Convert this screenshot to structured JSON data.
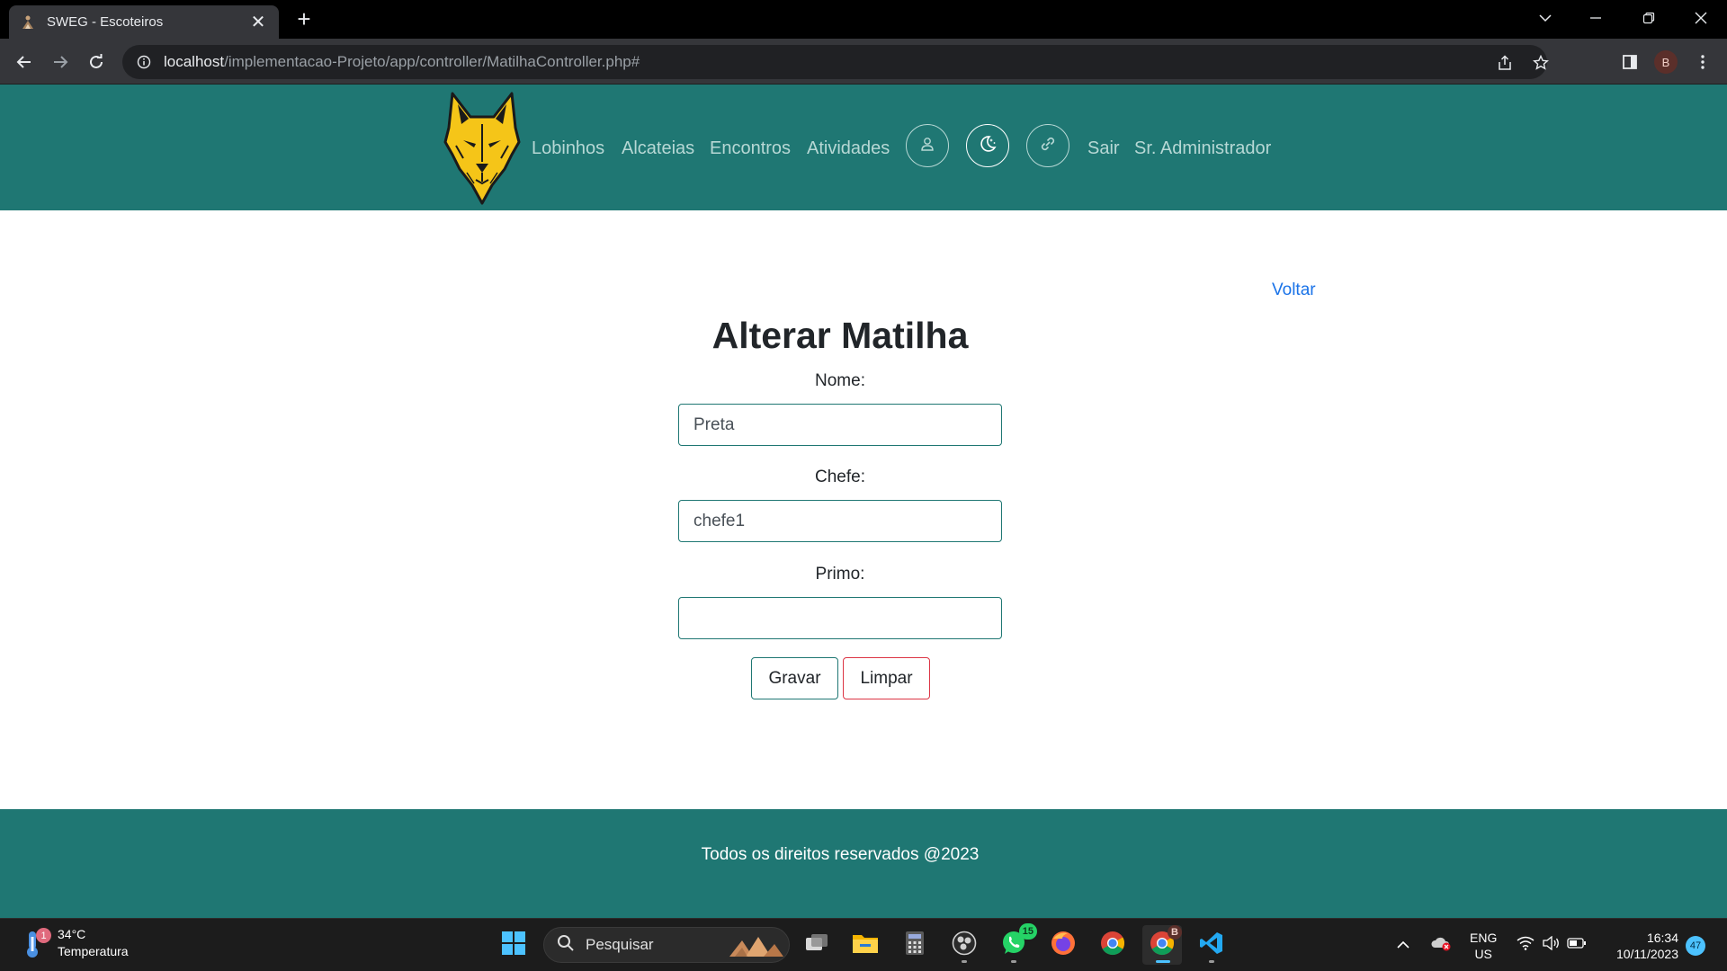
{
  "browser": {
    "tab_title": "SWEG - Escoteiros",
    "tab_close": "✕",
    "new_tab": "+",
    "url_host": "localhost",
    "url_path": "/implementacao-Projeto/app/controller/MatilhaController.php#",
    "profile_initial": "B"
  },
  "site": {
    "nav": [
      "Lobinhos",
      "Alcateias",
      "Encontros",
      "Atividades"
    ],
    "logout": "Sair",
    "user": "Sr. Administrador"
  },
  "page": {
    "back_link": "Voltar",
    "title": "Alterar Matilha",
    "fields": {
      "nome_label": "Nome:",
      "nome_value": "Preta",
      "chefe_label": "Chefe:",
      "chefe_value": "chefe1",
      "primo_label": "Primo:",
      "primo_value": ""
    },
    "buttons": {
      "save": "Gravar",
      "clear": "Limpar"
    }
  },
  "footer": {
    "text": "Todos os direitos reservados @2023"
  },
  "taskbar": {
    "weather_temp": "34°C",
    "weather_label": "Temperatura",
    "weather_badge": "1",
    "search_placeholder": "Pesquisar",
    "whatsapp_badge": "15",
    "chrome_profile_badge": "B",
    "lang_1": "ENG",
    "lang_2": "US",
    "time": "16:34",
    "date": "10/11/2023",
    "notifications": "47"
  },
  "colors": {
    "brand_teal": "#1f7773",
    "link_blue": "#1a73e8",
    "danger_red": "#dc3545"
  }
}
